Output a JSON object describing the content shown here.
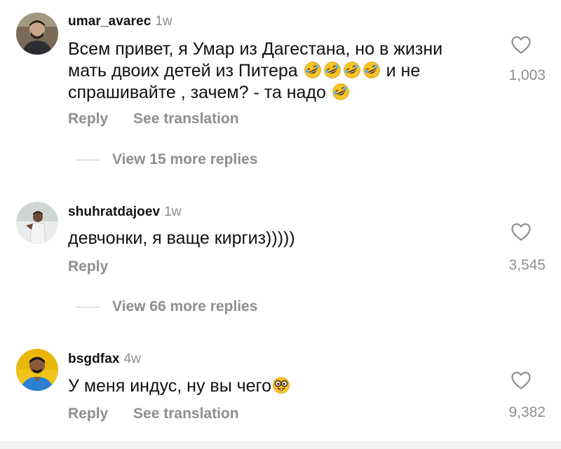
{
  "comments": [
    {
      "username": "umar_avarec",
      "time": "1w",
      "text_line1": "Всем привет, я Умар из Дагестана, но в жизни",
      "text_line2a": "мать двоих детей из Питера ",
      "text_line2b": " и не",
      "text_line3a": "спрашивайте , зачем? - та надо ",
      "reply_label": "Reply",
      "translate_label": "See translation",
      "likes": "1,003",
      "view_more": "View 15 more replies",
      "emoji_name": "rolling-on-floor-laughing"
    },
    {
      "username": "shuhratdajoev",
      "time": "1w",
      "text": "девчонки, я ваще киргиз)))))",
      "reply_label": "Reply",
      "likes": "3,545",
      "view_more": "View 66 more replies"
    },
    {
      "username": "bsgdfax",
      "time": "4w",
      "text": "У меня индус, ну вы чего",
      "reply_label": "Reply",
      "translate_label": "See translation",
      "likes": "9,382",
      "emoji_name": "nerd-face"
    }
  ],
  "icons": {
    "like": "heart-outline-icon",
    "laugh_emoji": "rolling-on-floor-laughing-emoji",
    "nerd_emoji": "nerd-face-emoji"
  },
  "colors": {
    "text": "#111111",
    "muted": "#8e8e8e",
    "emoji_yellow": "#f7c325"
  }
}
